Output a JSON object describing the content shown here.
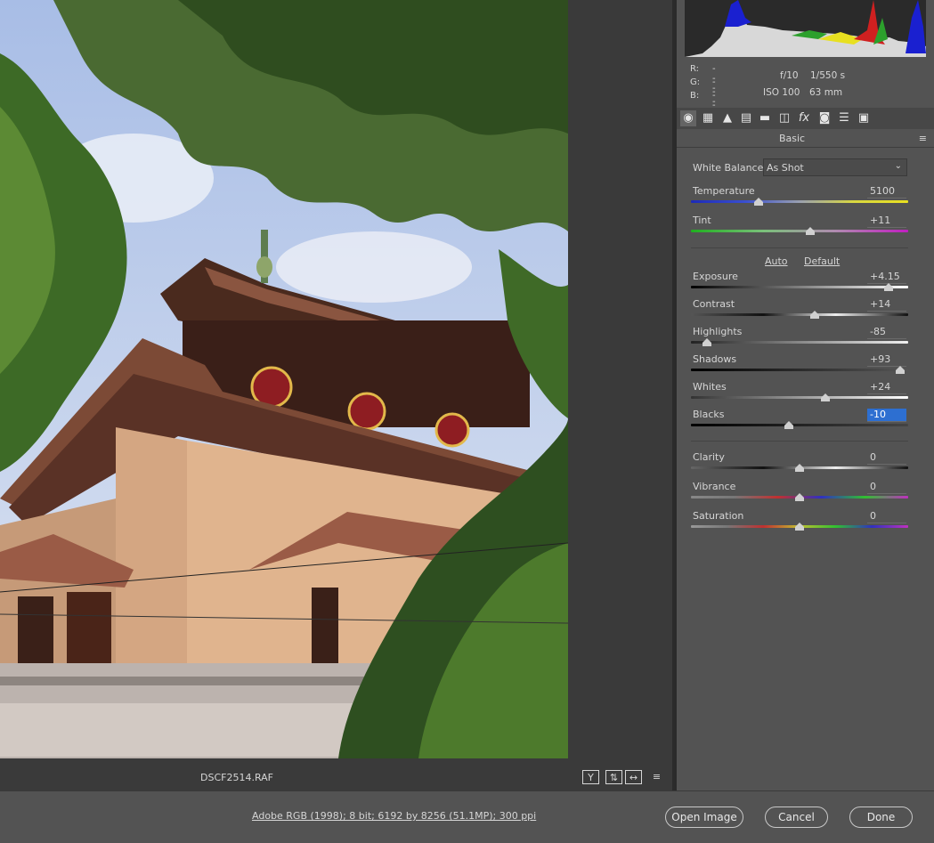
{
  "preview": {
    "filename": "DSCF2514.RAF",
    "view_buttons": [
      "Y",
      "⇅",
      "↔",
      "≡"
    ]
  },
  "readout": {
    "r_label": "R:",
    "r_value": "---",
    "g_label": "G:",
    "g_value": "---",
    "b_label": "B:",
    "b_value": "---",
    "aperture": "f/10",
    "shutter": "1/550 s",
    "iso": "ISO 100",
    "focal": "63 mm"
  },
  "tool_tabs": [
    "aperture-icon",
    "grid-icon",
    "mountains-icon",
    "split-icon",
    "detail-icon",
    "lens-icon",
    "fx-icon",
    "camera-icon",
    "presets-icon",
    "snapshots-icon"
  ],
  "panel": {
    "title": "Basic",
    "menu_icon": "≡",
    "white_balance_label": "White Balance:",
    "white_balance_value": "As Shot",
    "auto_label": "Auto",
    "default_label": "Default"
  },
  "sliders": {
    "temperature": {
      "label": "Temperature",
      "value": "5100",
      "pos": 0.31
    },
    "tint": {
      "label": "Tint",
      "value": "+11",
      "pos": 0.55
    },
    "exposure": {
      "label": "Exposure",
      "value": "+4.15",
      "pos": 0.91
    },
    "contrast": {
      "label": "Contrast",
      "value": "+14",
      "pos": 0.57
    },
    "highlights": {
      "label": "Highlights",
      "value": "-85",
      "pos": 0.075
    },
    "shadows": {
      "label": "Shadows",
      "value": "+93",
      "pos": 0.965
    },
    "whites": {
      "label": "Whites",
      "value": "+24",
      "pos": 0.62
    },
    "blacks": {
      "label": "Blacks",
      "value": "-10",
      "pos": 0.45
    },
    "clarity": {
      "label": "Clarity",
      "value": "0",
      "pos": 0.5
    },
    "vibrance": {
      "label": "Vibrance",
      "value": "0",
      "pos": 0.5
    },
    "saturation": {
      "label": "Saturation",
      "value": "0",
      "pos": 0.5
    }
  },
  "bottom": {
    "workflow_text": "Adobe RGB (1998); 8 bit; 6192 by 8256 (51.1MP); 300 ppi",
    "open_image": "Open Image",
    "cancel": "Cancel",
    "done": "Done"
  },
  "colors": {
    "panel_bg": "#535353",
    "preview_bg": "#3a3a3a",
    "selection": "#2d6fd1"
  }
}
